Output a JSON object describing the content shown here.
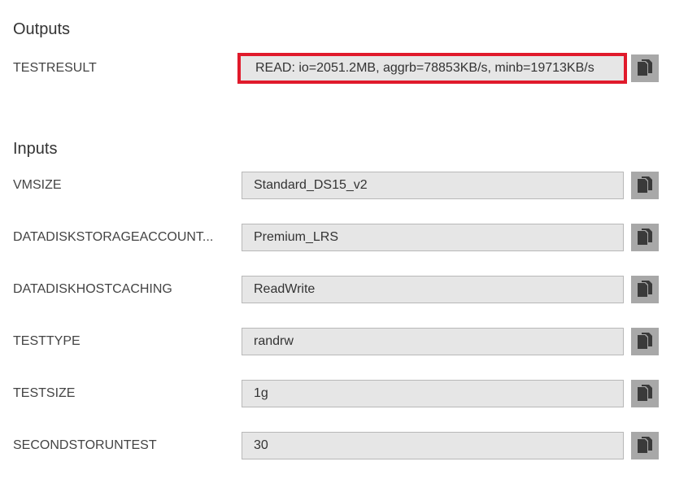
{
  "outputs": {
    "title": "Outputs",
    "items": [
      {
        "label": "TESTRESULT",
        "value": "READ: io=2051.2MB, aggrb=78853KB/s, minb=19713KB/s"
      }
    ]
  },
  "inputs": {
    "title": "Inputs",
    "items": [
      {
        "label": "VMSIZE",
        "value": "Standard_DS15_v2"
      },
      {
        "label": "DATADISKSTORAGEACCOUNT...",
        "value": "Premium_LRS"
      },
      {
        "label": "DATADISKHOSTCACHING",
        "value": "ReadWrite"
      },
      {
        "label": "TESTTYPE",
        "value": "randrw"
      },
      {
        "label": "TESTSIZE",
        "value": "1g"
      },
      {
        "label": "SECONDSTORUNTEST",
        "value": "30"
      }
    ]
  },
  "colors": {
    "highlight_border": "#e01a2b",
    "field_background": "#e6e6e6",
    "copy_button": "#a8a8a8"
  },
  "icons": {
    "copy": "copy-icon"
  }
}
